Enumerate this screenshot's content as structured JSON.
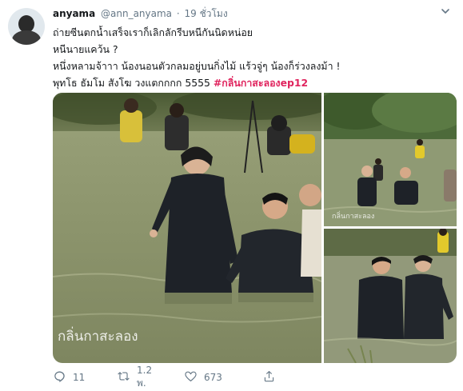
{
  "author": {
    "display_name": "anyama",
    "handle": "@ann_anyama",
    "separator": "·",
    "timestamp": "19 ชั่วโมง"
  },
  "tweet": {
    "lines": [
      "ถ่ายซีนตกน้ำเสร็จเราก็เลิกลักรีบหนีกันนิดหน่อย",
      "หนีนายแคว้น ?",
      "หนึ่งหลามจ้าาา น้องนอนตัวกลมอยู่บนกิ่งไม้ แร้วจู่ๆ น้องก็ร่วงลงม้า !",
      "พุทโธ ธัมโม สังโฆ วงแตกกกก 5555"
    ],
    "hashtag": "#กลิ่นกาสะลองep12"
  },
  "media": {
    "watermark": "กลิ่นกาสะลอง"
  },
  "actions": {
    "replies": "11",
    "retweets": "1.2 พ.",
    "likes": "673"
  },
  "colors": {
    "hashtag": "#e0245e",
    "muted": "#657786",
    "text": "#14171a"
  }
}
